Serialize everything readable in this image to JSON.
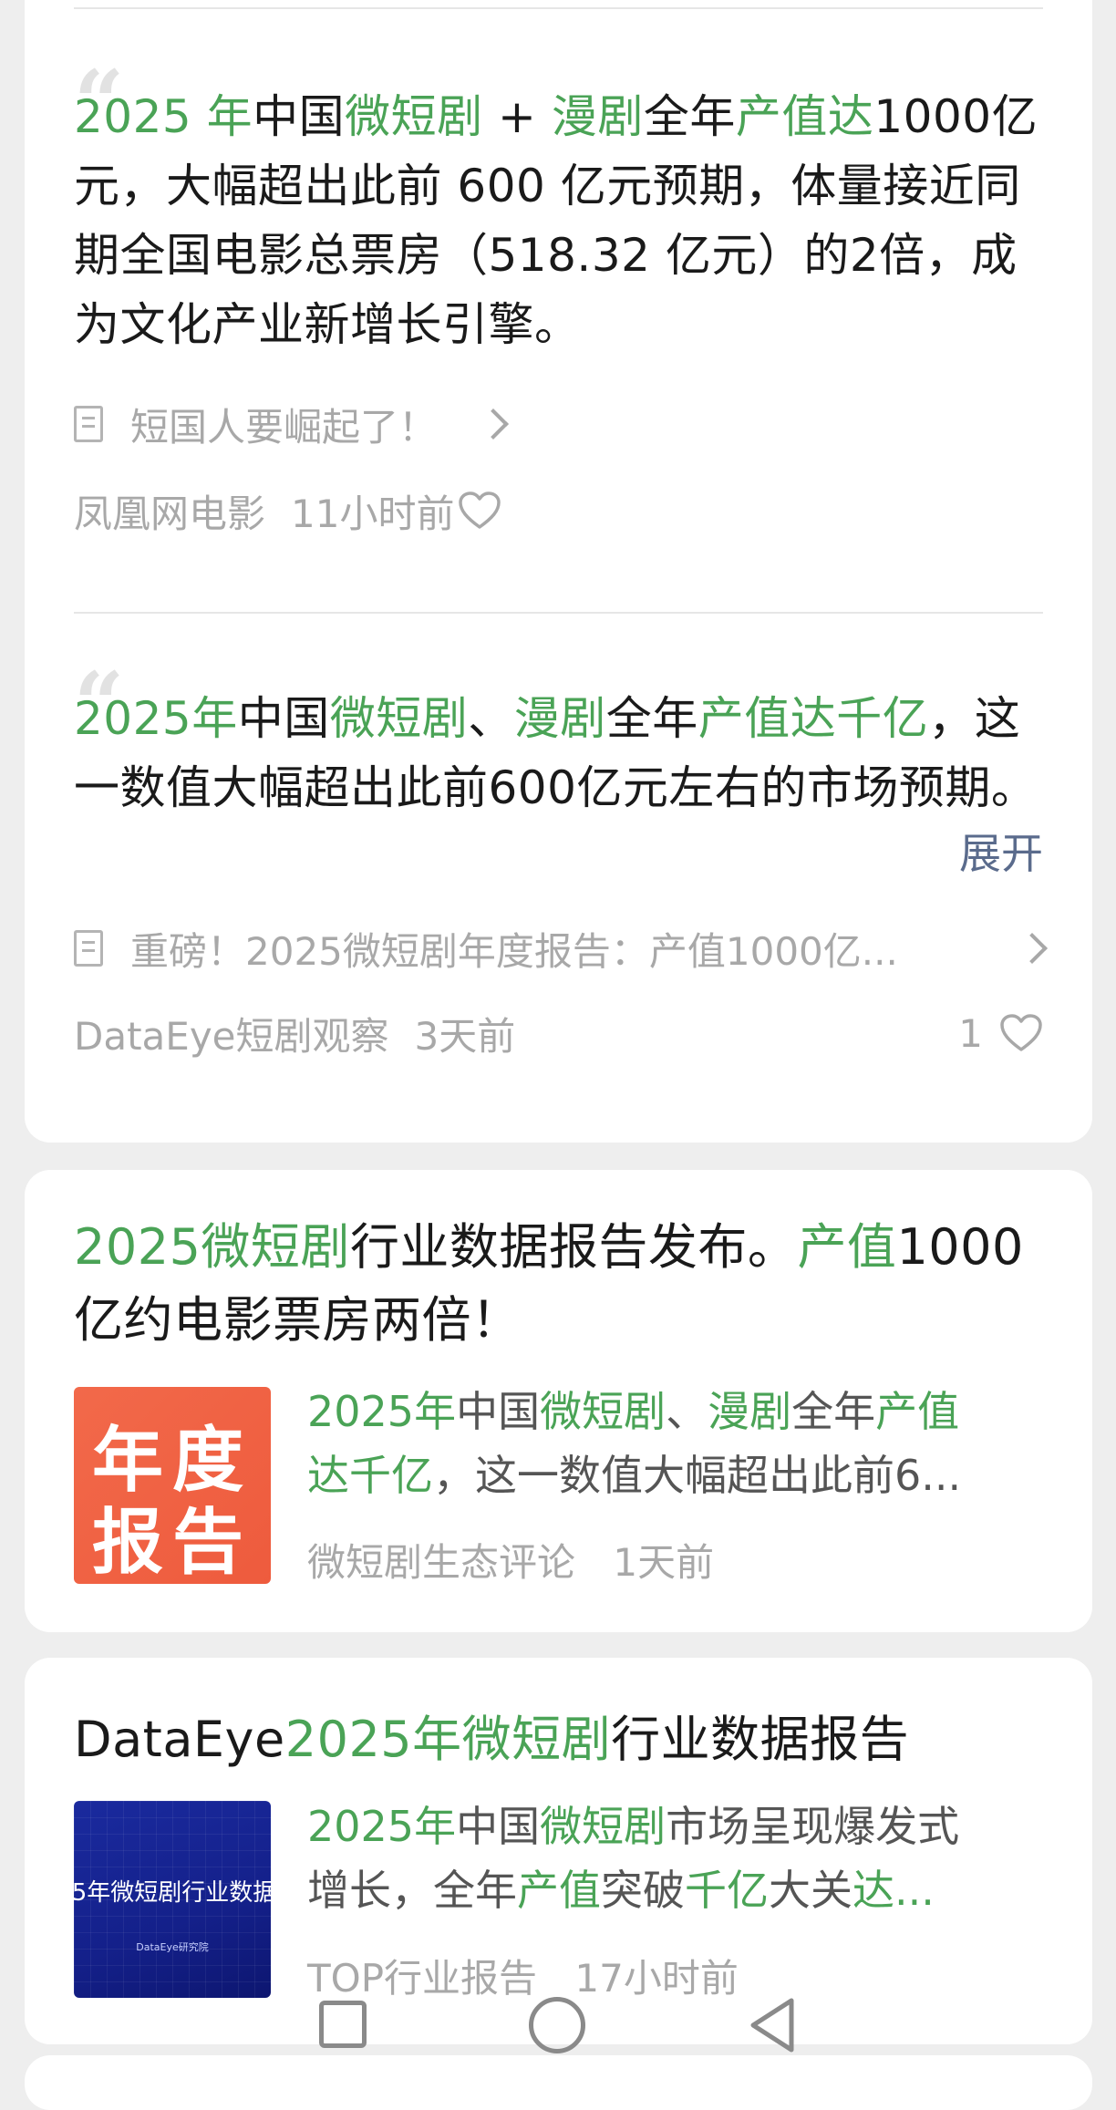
{
  "post1": {
    "quote_icon": "quote-icon",
    "snippet": [
      {
        "t": "2025 年",
        "hl": true
      },
      {
        "t": "中国",
        "hl": false
      },
      {
        "t": "微短剧",
        "hl": true
      },
      {
        "t": " + ",
        "hl": false
      },
      {
        "t": "漫剧",
        "hl": true
      },
      {
        "t": "全年",
        "hl": false
      },
      {
        "t": "产值达",
        "hl": true
      },
      {
        "t": "1000亿元，大幅超出此前 600 亿元预期，体量接近同期全国电影总票房（518.32 亿元）的2倍，成为文化产业新增长引擎。",
        "hl": false
      }
    ],
    "link_text": "短国人要崛起了！",
    "source": "凤凰网电影",
    "time": "11小时前",
    "likes": ""
  },
  "post2": {
    "quote_icon": "quote-icon",
    "snippet": [
      {
        "t": "2025年",
        "hl": true
      },
      {
        "t": "中国",
        "hl": false
      },
      {
        "t": "微短剧",
        "hl": true
      },
      {
        "t": "、",
        "hl": false
      },
      {
        "t": "漫剧",
        "hl": true
      },
      {
        "t": "全年",
        "hl": false
      },
      {
        "t": "产值达千亿",
        "hl": true
      },
      {
        "t": "，这一数值大幅超出此前600亿元左右的市场预期。",
        "hl": false
      }
    ],
    "expand_label": "展开",
    "link_text": "重磅！2025微短剧年度报告：产值1000亿...",
    "source": "DataEye短剧观察",
    "time": "3天前",
    "likes": "1"
  },
  "article1": {
    "title": [
      {
        "t": "2025微短剧",
        "hl": true
      },
      {
        "t": "行业数据报告发布。",
        "hl": false
      },
      {
        "t": "产值",
        "hl": true
      },
      {
        "t": "1000亿约电影票房两倍！",
        "hl": false
      }
    ],
    "thumb_line1": "年度",
    "thumb_line2": "报告",
    "summary_line1": [
      {
        "t": "2025年",
        "hl": true
      },
      {
        "t": "中国",
        "hl": false
      },
      {
        "t": "微短剧",
        "hl": true
      },
      {
        "t": "、",
        "hl": false
      },
      {
        "t": "漫剧",
        "hl": true
      },
      {
        "t": "全年",
        "hl": false
      },
      {
        "t": "产值",
        "hl": true
      }
    ],
    "summary_line2": [
      {
        "t": "达千亿",
        "hl": true
      },
      {
        "t": "，这一数值大幅超出此前6...",
        "hl": false
      }
    ],
    "source": "微短剧生态评论",
    "time": "1天前"
  },
  "article2": {
    "title": [
      {
        "t": "DataEye",
        "hl": false
      },
      {
        "t": "2025年微短剧",
        "hl": true
      },
      {
        "t": "行业数据报告",
        "hl": false
      }
    ],
    "thumb_text": "5年微短剧行业数据",
    "thumb_sub": "DataEye研究院",
    "summary_line1": [
      {
        "t": "2025年",
        "hl": true
      },
      {
        "t": "中国",
        "hl": false
      },
      {
        "t": "微短剧",
        "hl": true
      },
      {
        "t": "市场呈现爆发式",
        "hl": false
      }
    ],
    "summary_line2": [
      {
        "t": "增长，全年",
        "hl": false
      },
      {
        "t": "产值",
        "hl": true
      },
      {
        "t": "突破",
        "hl": false
      },
      {
        "t": "千亿",
        "hl": true
      },
      {
        "t": "大关",
        "hl": false
      },
      {
        "t": "达...",
        "hl": true
      }
    ],
    "source": "TOP行业报告",
    "time": "17小时前"
  },
  "navbar": {
    "recent_icon": "square-icon",
    "home_icon": "circle-icon",
    "back_icon": "triangle-back-icon"
  },
  "colors": {
    "highlight": "#4aa356",
    "expand": "#5a6b8c",
    "meta": "#a8a8a8",
    "background": "#eeeeee"
  }
}
